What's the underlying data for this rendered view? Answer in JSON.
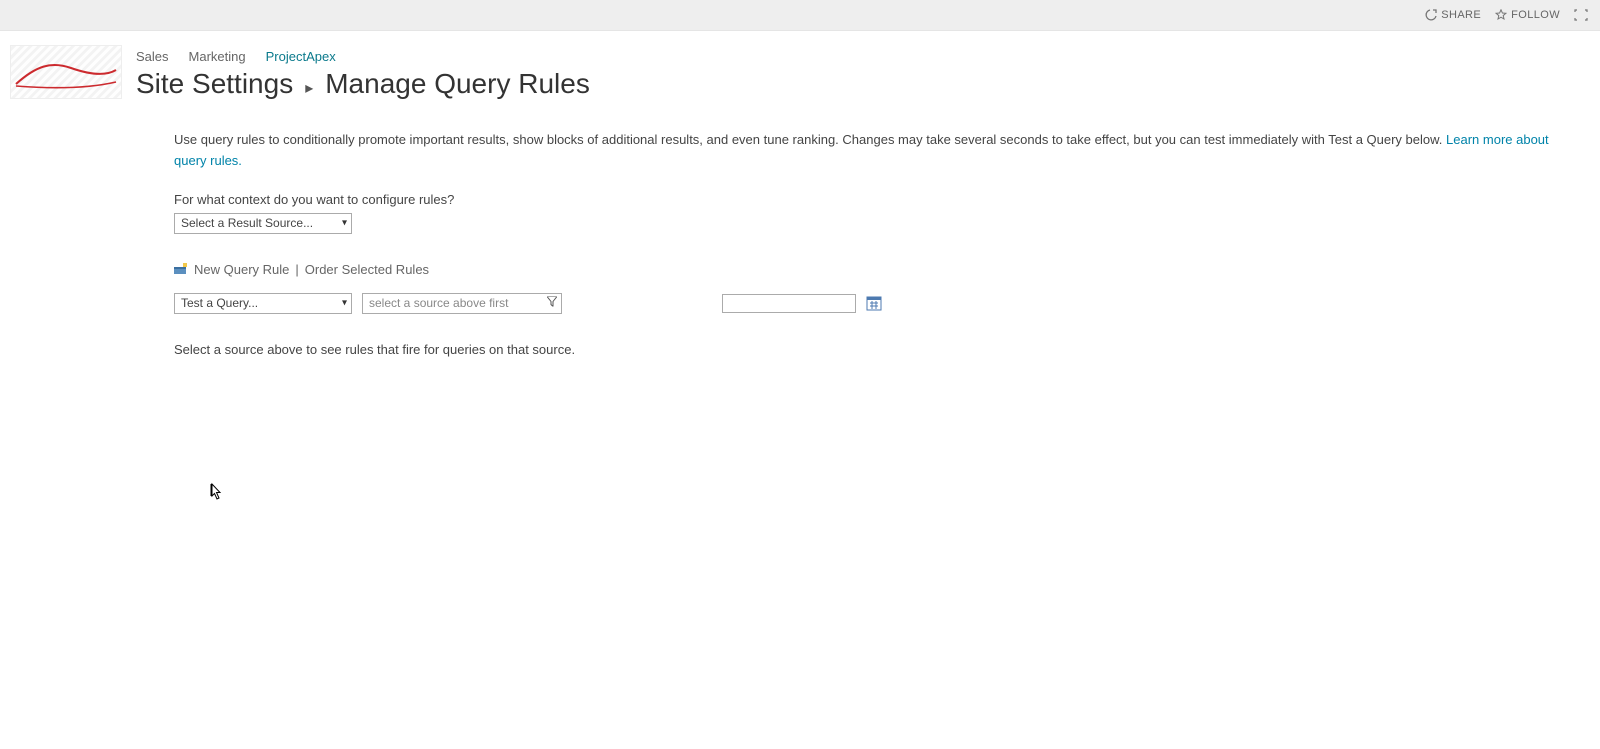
{
  "ribbon": {
    "share_label": "SHARE",
    "follow_label": "FOLLOW"
  },
  "nav": {
    "items": [
      {
        "label": "Sales",
        "selected": false
      },
      {
        "label": "Marketing",
        "selected": false
      },
      {
        "label": "ProjectApex",
        "selected": true
      }
    ]
  },
  "title": {
    "breadcrumb": "Site Settings",
    "current": "Manage Query Rules"
  },
  "intro": {
    "text": "Use query rules to conditionally promote important results, show blocks of additional results, and even tune ranking. Changes may take several seconds to take effect, but you can test immediately with Test a Query below. ",
    "link_text": "Learn more about query rules.",
    "tail": ""
  },
  "context_label": "For what context do you want to configure rules?",
  "result_source_placeholder": "Select a Result Source...",
  "toolbar": {
    "new_rule": "New Query Rule",
    "order_rules": "Order Selected Rules"
  },
  "test_query_label": "Test a Query...",
  "source_filter_placeholder": "select a source above first",
  "hint": "Select a source above to see rules that fire for queries on that source."
}
